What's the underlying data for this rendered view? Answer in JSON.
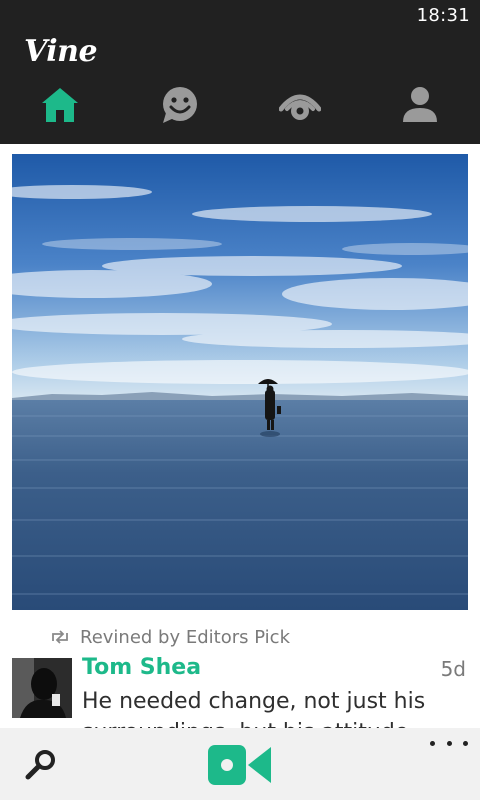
{
  "status": {
    "time": "18:31"
  },
  "app": {
    "title": "Vine",
    "accent": "#1db98a"
  },
  "tabs": [
    {
      "name": "home",
      "icon": "home-icon",
      "selected": true
    },
    {
      "name": "activity",
      "icon": "smiley-chat-icon",
      "selected": false
    },
    {
      "name": "explore",
      "icon": "eye-icon",
      "selected": false
    },
    {
      "name": "profile",
      "icon": "person-icon",
      "selected": false
    }
  ],
  "post": {
    "revined_label": "Revined by Editors Pick",
    "username": "Tom Shea",
    "age": "5d",
    "caption": "He needed change, not just his surroundings, but his attitude. So",
    "video_scene": "person-with-umbrella-in-water"
  },
  "appbar": {
    "search_icon": "search-icon",
    "record_icon": "video-camera-icon",
    "more_icon": "more-icon"
  }
}
